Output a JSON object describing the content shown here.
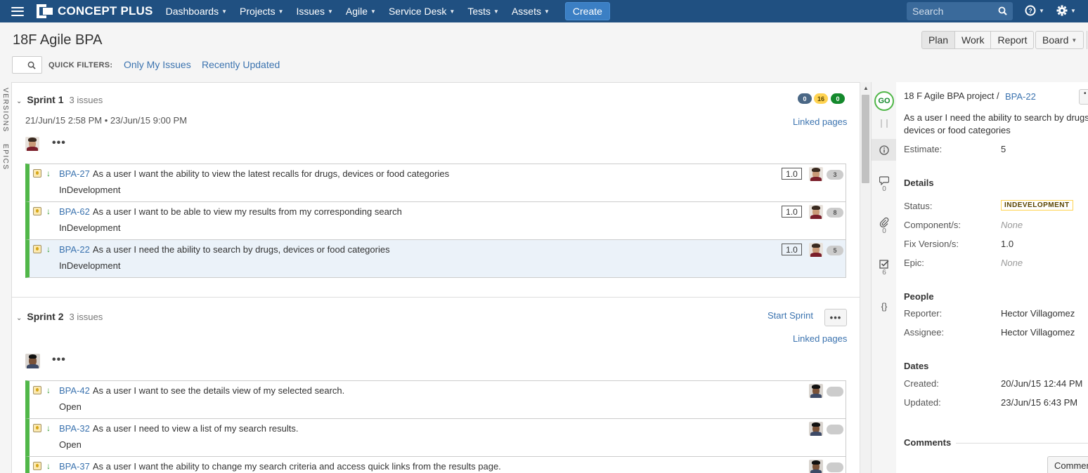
{
  "nav": {
    "brand": "CONCEPT PLUS",
    "menus": [
      "Dashboards",
      "Projects",
      "Issues",
      "Agile",
      "Service Desk",
      "Tests",
      "Assets"
    ],
    "create_label": "Create",
    "search_placeholder": "Search",
    "help_icon": "help-icon",
    "settings_icon": "gear-icon"
  },
  "board": {
    "title": "18F Agile BPA",
    "modes": [
      "Plan",
      "Work",
      "Report"
    ],
    "active_mode": "Plan",
    "board_menu": "Board"
  },
  "quick_filters": {
    "label": "QUICK FILTERS:",
    "filters": [
      "Only My Issues",
      "Recently Updated"
    ]
  },
  "side_tabs": [
    "VERSIONS",
    "EPICS"
  ],
  "sprints": [
    {
      "name": "Sprint 1",
      "count": "3 issues",
      "dates": "21/Jun/15 2:58 PM • 23/Jun/15 9:00 PM",
      "status_counts": [
        "0",
        "16",
        "0"
      ],
      "status_colors": [
        "#4a6785",
        "#ffd351",
        "#14892c"
      ],
      "linked_pages": "Linked pages",
      "issues": [
        {
          "key": "BPA-27",
          "summary": "As a user I want the ability to view the latest recalls for drugs, devices or food categories",
          "status": "InDevelopment",
          "version": "1.0",
          "points": "3",
          "selected": false
        },
        {
          "key": "BPA-62",
          "summary": "As a user I want to be able to view my results from my corresponding search",
          "status": "InDevelopment",
          "version": "1.0",
          "points": "8",
          "selected": false
        },
        {
          "key": "BPA-22",
          "summary": "As a user I need the ability to search by drugs, devices or food categories",
          "status": "InDevelopment",
          "version": "1.0",
          "points": "5",
          "selected": true
        }
      ]
    },
    {
      "name": "Sprint 2",
      "count": "3 issues",
      "start_sprint": "Start Sprint",
      "linked_pages": "Linked pages",
      "issues": [
        {
          "key": "BPA-42",
          "summary": "As a user I want to see the details view of my selected search.",
          "status": "Open",
          "points": "",
          "selected": false
        },
        {
          "key": "BPA-32",
          "summary": "As a user I need to view a list of my search results.",
          "status": "Open",
          "points": "",
          "selected": false
        },
        {
          "key": "BPA-37",
          "summary": "As a user I want the ability to change my search criteria and access quick links from the results page.",
          "status": "",
          "points": "",
          "selected": false
        }
      ]
    }
  ],
  "detail": {
    "go_badge": "GO",
    "project": "18 F Agile BPA project /",
    "key": "BPA-22",
    "summary_line1": "As a user I need the ability to search by drugs,",
    "summary_line2": "devices or food categories",
    "estimate_label": "Estimate:",
    "estimate_value": "5",
    "rail_counts": {
      "comments": "0",
      "attachments": "0",
      "subtasks": "6"
    },
    "details_heading": "Details",
    "status_label": "Status:",
    "status_value": "INDEVELOPMENT",
    "component_label": "Component/s:",
    "component_value": "None",
    "fix_label": "Fix Version/s:",
    "fix_value": "1.0",
    "epic_label": "Epic:",
    "epic_value": "None",
    "people_heading": "People",
    "reporter_label": "Reporter:",
    "reporter_value": "Hector Villagomez",
    "assignee_label": "Assignee:",
    "assignee_value": "Hector Villagomez",
    "dates_heading": "Dates",
    "created_label": "Created:",
    "created_value": "20/Jun/15 12:44 PM",
    "updated_label": "Updated:",
    "updated_value": "23/Jun/15 6:43 PM",
    "comments_heading": "Comments",
    "comment_button": "Commen"
  }
}
